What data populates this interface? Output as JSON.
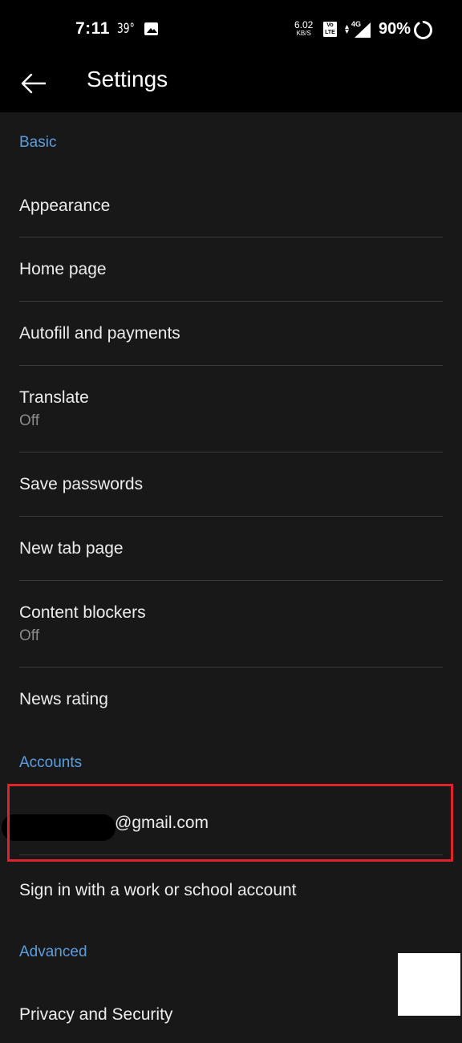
{
  "status_bar": {
    "time": "7:11",
    "temperature": "39°",
    "notification_icon": "gallery-icon",
    "net_speed_value": "6.02",
    "net_speed_unit": "KB/S",
    "volte_label": "Vo LTE",
    "network_type": "4G",
    "battery_percent": "90%"
  },
  "app_bar": {
    "back_icon": "arrow-left-icon",
    "title": "Settings"
  },
  "colors": {
    "accent": "#5b9ee0",
    "background": "#181818",
    "highlight": "#e0232a"
  },
  "sections": [
    {
      "header": "Basic",
      "items": [
        {
          "title": "Appearance"
        },
        {
          "title": "Home page"
        },
        {
          "title": "Autofill and payments"
        },
        {
          "title": "Translate",
          "subtitle": "Off"
        },
        {
          "title": "Save passwords"
        },
        {
          "title": "New tab page"
        },
        {
          "title": "Content blockers",
          "subtitle": "Off"
        },
        {
          "title": "News rating"
        }
      ]
    },
    {
      "header": "Accounts",
      "items": [
        {
          "title": "@gmail.com"
        },
        {
          "title": "Sign in with a work or school account"
        }
      ]
    },
    {
      "header": "Advanced",
      "items": [
        {
          "title": "Privacy and Security"
        }
      ]
    }
  ]
}
